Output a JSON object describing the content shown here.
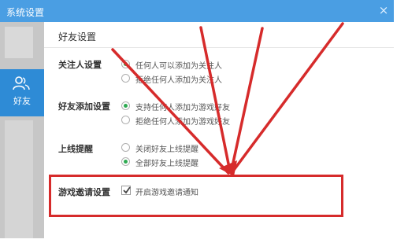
{
  "window": {
    "title": "系统设置",
    "close_glyph": "×"
  },
  "sidebar": {
    "active_item": {
      "label": "好友",
      "icon": "friends-icon"
    }
  },
  "panel": {
    "title": "好友设置",
    "sections": [
      {
        "label": "关注人设置",
        "options": [
          {
            "type": "radio",
            "label": "任何人可以添加为关注人",
            "checked": true
          },
          {
            "type": "radio",
            "label": "拒绝任何人添加为关注人",
            "checked": false
          }
        ]
      },
      {
        "label": "好友添加设置",
        "options": [
          {
            "type": "radio",
            "label": "支持任何人添加为游戏好友",
            "checked": true
          },
          {
            "type": "radio",
            "label": "拒绝任何人添加为游戏好友",
            "checked": false
          }
        ]
      },
      {
        "label": "上线提醒",
        "options": [
          {
            "type": "radio",
            "label": "关闭好友上线提醒",
            "checked": false
          },
          {
            "type": "radio",
            "label": "全部好友上线提醒",
            "checked": true
          }
        ]
      },
      {
        "label": "游戏邀请设置",
        "options": [
          {
            "type": "checkbox",
            "label": "开启游戏邀请通知",
            "checked": true
          }
        ]
      }
    ]
  },
  "colors": {
    "titlebar": "#4a9ee3",
    "sidebar_active": "#2e8bd6",
    "radio_selected": "#2eaa52",
    "annotation": "#d62b2b"
  }
}
